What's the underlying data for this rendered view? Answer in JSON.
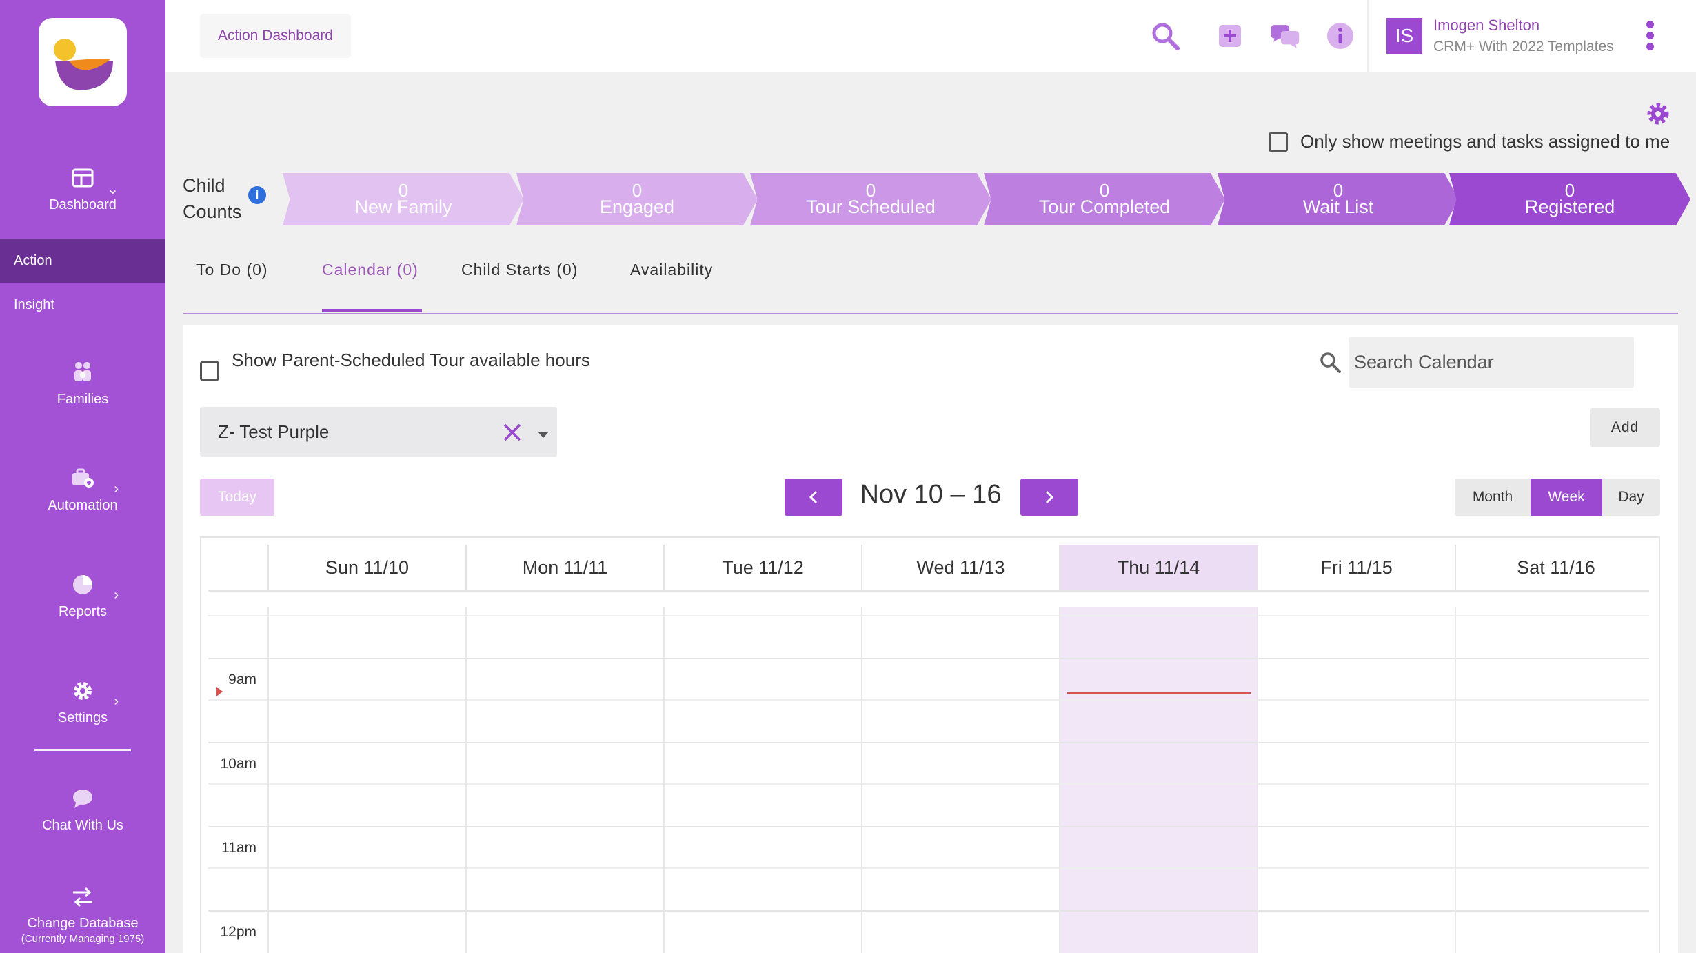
{
  "sidebar": {
    "items": [
      {
        "label": "Dashboard",
        "icon": "dashboard-icon"
      },
      {
        "label": "Action"
      },
      {
        "label": "Insight"
      },
      {
        "label": "Families",
        "icon": "families-icon"
      },
      {
        "label": "Automation",
        "icon": "automation-icon"
      },
      {
        "label": "Reports",
        "icon": "pie-chart-icon"
      },
      {
        "label": "Settings",
        "icon": "gear-icon"
      },
      {
        "label": "Chat With Us",
        "icon": "chat-bubble-icon"
      },
      {
        "label": "Change Database",
        "sub": "(Currently Managing 1975)",
        "icon": "swap-arrows-icon"
      }
    ],
    "active_color": "#6a2f93",
    "bg_color": "#a352d6"
  },
  "header": {
    "breadcrumb": "Action Dashboard",
    "icons": [
      "search-icon",
      "plus-square-icon",
      "chat-icon",
      "info-icon"
    ],
    "user": {
      "initials": "IS",
      "name": "Imogen Shelton",
      "subtitle": "CRM+ With 2022 Templates"
    }
  },
  "filters": {
    "only_assigned_label": "Only show meetings and tasks assigned to me",
    "only_assigned_checked": false
  },
  "pipeline": {
    "label_line1": "Child",
    "label_line2": "Counts",
    "info": "i",
    "stages": [
      {
        "count": "0",
        "name": "New Family",
        "color": "#e2c2f0"
      },
      {
        "count": "0",
        "name": "Engaged",
        "color": "#d8aeed"
      },
      {
        "count": "0",
        "name": "Tour Scheduled",
        "color": "#cb97e6"
      },
      {
        "count": "0",
        "name": "Tour Completed",
        "color": "#bd80e0"
      },
      {
        "count": "0",
        "name": "Wait List",
        "color": "#ac66d8"
      },
      {
        "count": "0",
        "name": "Registered",
        "color": "#9b49d0"
      }
    ]
  },
  "tabs": [
    {
      "label": "To Do (0)",
      "active": false
    },
    {
      "label": "Calendar (0)",
      "active": true
    },
    {
      "label": "Child Starts (0)",
      "active": false
    },
    {
      "label": "Availability",
      "active": false
    }
  ],
  "calendar": {
    "show_parent_tour_label": "Show Parent-Scheduled Tour available hours",
    "show_parent_tour_checked": false,
    "search_placeholder": "Search Calendar",
    "selected_center": "Z- Test Purple",
    "add_label": "Add",
    "today_label": "Today",
    "range_title": "Nov 10 – 16",
    "views": [
      {
        "label": "Month",
        "active": false
      },
      {
        "label": "Week",
        "active": true
      },
      {
        "label": "Day",
        "active": false
      }
    ],
    "days": [
      "Sun 11/10",
      "Mon 11/11",
      "Tue 11/12",
      "Wed 11/13",
      "Thu 11/14",
      "Fri 11/15",
      "Sat 11/16"
    ],
    "today_index": 4,
    "times": [
      "9am",
      "10am",
      "11am",
      "12pm"
    ],
    "accent": "#9b49d0"
  }
}
